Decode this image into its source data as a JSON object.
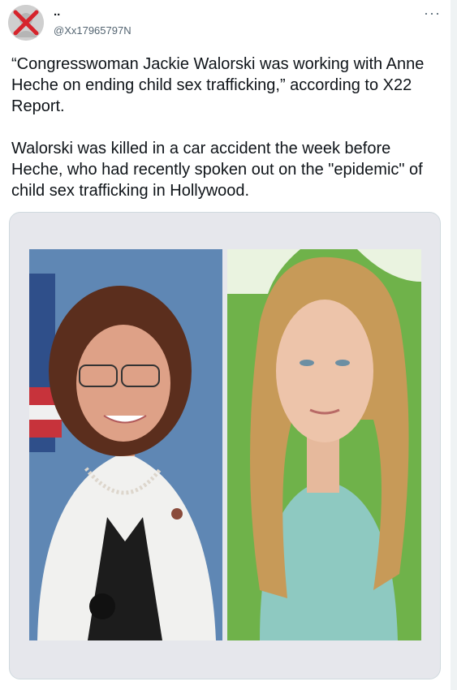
{
  "author": {
    "display_name": "..",
    "handle": "@Xx17965797N"
  },
  "icons": {
    "avatar": "red-x-avatar-icon",
    "more": "more-options-icon"
  },
  "more_glyph": "···",
  "tweet": {
    "paragraph_1": "“Congresswoman Jackie Walorski was working with Anne Heche on ending child sex trafficking,” according to X22 Report.",
    "paragraph_2": "Walorski was killed in a car accident the week before Heche, who had recently spoken out on the \"epidemic\" of child sex trafficking in Hollywood."
  },
  "colors": {
    "left_photo_background": "#5f87b4",
    "right_photo_background": "#6fb24a",
    "dress": "#8ec9c1",
    "jacket": "#f1f1ef"
  }
}
